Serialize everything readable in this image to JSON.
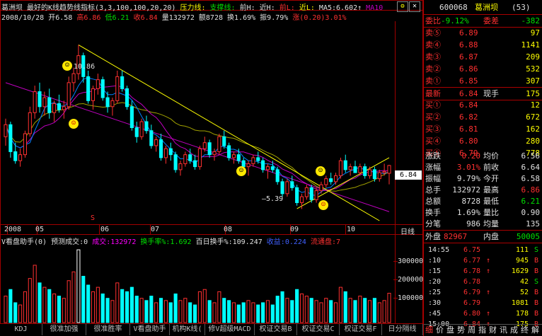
{
  "header": {
    "stock_name": "葛洲坝",
    "indicator_title": "最好的K线趋势线指标(3,3,100,100,20,20)",
    "pressure_label": "压力线:",
    "support_label": "支撑线:",
    "prev_high_label": "前H:",
    "recent_high_label": "近H:",
    "prev_low_label": "前L:",
    "recent_low_label": "近L:",
    "ma5_label": "MA5:6.602↑",
    "ma10_label": "MA10",
    "date": "2008/10/28",
    "open": "开6.58",
    "high": "高6.86",
    "low": "低6.21",
    "close": "收6.84",
    "volume": "量132972",
    "amount": "额8728",
    "turnover": "换1.69%",
    "amplitude": "振9.79%",
    "change": "涨(0.20)3.01%"
  },
  "annotations": {
    "high_label": "10.86",
    "low_label": "5.39",
    "price_tag": "6.84",
    "s_marker": "S"
  },
  "xaxis": {
    "labels": [
      "2008",
      "05",
      "06",
      "07",
      "08",
      "09",
      "10"
    ],
    "right_label": "日线"
  },
  "vol_header": {
    "title": "V看盘助手(0)",
    "forecast": "预测成交:0",
    "volume": "成交:132972",
    "turnover_rate": "换手率%:1.692",
    "hundred_day": "百日换手%:109.247",
    "profit": "收益:0.224",
    "float": "流通盘:7"
  },
  "vol_axis": [
    "300000",
    "200000",
    "100000"
  ],
  "toolbar": [
    "KDJ",
    "很准加强",
    "很准胜率",
    "V看盘助手",
    "机构K线(",
    "修V超级MACD",
    "权证交易B",
    "权证交易C",
    "权证交易F",
    "日分隔线"
  ],
  "toolbar_right": [
    "细",
    "价",
    "盘",
    "势",
    "周",
    "指",
    "财",
    "讯",
    "成",
    "终",
    "解"
  ],
  "quote": {
    "code": "600068",
    "name": "葛洲坝",
    "count": "(53)",
    "weibi_label": "委比",
    "weibi_value": "-9.12%",
    "weicha_label": "委差",
    "weicha_value": "-382",
    "sells": [
      {
        "label": "卖⑤",
        "price": "6.89",
        "vol": "97"
      },
      {
        "label": "卖④",
        "price": "6.88",
        "vol": "1141"
      },
      {
        "label": "卖③",
        "price": "6.87",
        "vol": "209"
      },
      {
        "label": "卖②",
        "price": "6.86",
        "vol": "532"
      },
      {
        "label": "卖①",
        "price": "6.85",
        "vol": "307"
      }
    ],
    "latest_label": "最新",
    "latest_value": "6.84",
    "xianshou_label": "现手",
    "xianshou_value": "175",
    "buys": [
      {
        "label": "买①",
        "price": "6.84",
        "vol": "12"
      },
      {
        "label": "买②",
        "price": "6.82",
        "vol": "672"
      },
      {
        "label": "买③",
        "price": "6.81",
        "vol": "162"
      },
      {
        "label": "买④",
        "price": "6.80",
        "vol": "280"
      },
      {
        "label": "买⑤",
        "price": "6.79",
        "vol": "778"
      }
    ],
    "stats": [
      {
        "l1": "涨跌",
        "v1": "0.20",
        "c1": "red",
        "l2": "均价",
        "v2": "6.56",
        "c2": "white"
      },
      {
        "l1": "涨幅",
        "v1": "3.01%",
        "c1": "red",
        "l2": "前收",
        "v2": "6.64",
        "c2": "white"
      },
      {
        "l1": "振幅",
        "v1": "9.79%",
        "c1": "white",
        "l2": "今开",
        "v2": "6.58",
        "c2": "white"
      },
      {
        "l1": "总手",
        "v1": "132972",
        "c1": "white",
        "l2": "最高",
        "v2": "6.86",
        "c2": "red"
      },
      {
        "l1": "总额",
        "v1": "8728",
        "c1": "white",
        "l2": "最低",
        "v2": "6.21",
        "c2": "green"
      },
      {
        "l1": "换手",
        "v1": "1.69%",
        "c1": "white",
        "l2": "量比",
        "v2": "0.90",
        "c2": "white"
      },
      {
        "l1": "分笔",
        "v1": "986",
        "c1": "white",
        "l2": "均量",
        "v2": "135",
        "c2": "white"
      }
    ],
    "outer_label": "外盘",
    "outer_value": "82967",
    "inner_label": "内盘",
    "inner_value": "50005"
  },
  "ticks": [
    {
      "time": "14:55",
      "price": "6.75",
      "arrow": "",
      "vol": "111",
      "side": "S"
    },
    {
      "time": ":10",
      "price": "6.77",
      "arrow": "↑",
      "vol": "945",
      "side": "B"
    },
    {
      "time": ":15",
      "price": "6.78",
      "arrow": "↑",
      "vol": "1629",
      "side": "B"
    },
    {
      "time": ":20",
      "price": "6.78",
      "arrow": "",
      "vol": "42",
      "side": "S"
    },
    {
      "time": ":25",
      "price": "6.79",
      "arrow": "↑",
      "vol": "52",
      "side": "B"
    },
    {
      "time": ":30",
      "price": "6.79",
      "arrow": "",
      "vol": "1081",
      "side": "B"
    },
    {
      "time": ":45",
      "price": "6.80",
      "arrow": "↑",
      "vol": "178",
      "side": "B"
    },
    {
      "time": "15:00",
      "price": "6.84",
      "arrow": "↑",
      "vol": "175",
      "side": "B"
    }
  ],
  "colors": {
    "up": "#ff3030",
    "down": "#00ffff",
    "ma5": "#ffffff",
    "ma10": "#c8c800",
    "ma20": "#c000c0",
    "ma60": "#0080ff",
    "trend": "#ffff00",
    "grid": "#a00000"
  },
  "chart_data": {
    "type": "candlestick",
    "ylim": [
      5.0,
      11.6
    ],
    "candles": [
      [
        7.8,
        8.4,
        7.5,
        8.2
      ],
      [
        8.2,
        8.3,
        7.1,
        7.3
      ],
      [
        7.3,
        7.6,
        6.9,
        7.0
      ],
      [
        7.0,
        7.4,
        6.8,
        7.2
      ],
      [
        7.2,
        8.0,
        7.1,
        7.9
      ],
      [
        7.9,
        8.8,
        7.8,
        8.6
      ],
      [
        8.6,
        9.5,
        8.4,
        9.3
      ],
      [
        9.3,
        9.6,
        8.6,
        8.8
      ],
      [
        8.8,
        9.3,
        8.5,
        9.1
      ],
      [
        9.1,
        9.4,
        8.4,
        8.6
      ],
      [
        8.6,
        9.0,
        8.3,
        8.9
      ],
      [
        8.9,
        9.2,
        8.6,
        8.7
      ],
      [
        8.7,
        9.0,
        8.4,
        8.8
      ],
      [
        8.8,
        9.8,
        8.7,
        9.6
      ],
      [
        9.6,
        10.1,
        9.3,
        9.9
      ],
      [
        9.9,
        10.86,
        9.7,
        10.5
      ],
      [
        10.5,
        10.6,
        9.6,
        9.8
      ],
      [
        9.8,
        10.0,
        8.9,
        9.0
      ],
      [
        9.0,
        9.5,
        8.7,
        9.4
      ],
      [
        9.4,
        9.9,
        9.2,
        9.7
      ],
      [
        9.7,
        9.8,
        9.0,
        9.1
      ],
      [
        9.1,
        9.3,
        8.6,
        8.8
      ],
      [
        8.8,
        9.1,
        8.5,
        9.0
      ],
      [
        9.0,
        10.0,
        8.9,
        9.8
      ],
      [
        9.8,
        10.0,
        9.3,
        9.4
      ],
      [
        9.4,
        9.5,
        8.7,
        8.8
      ],
      [
        8.8,
        9.0,
        8.0,
        8.1
      ],
      [
        8.1,
        8.3,
        7.6,
        7.8
      ],
      [
        7.8,
        8.4,
        7.7,
        8.3
      ],
      [
        8.3,
        8.5,
        7.9,
        8.0
      ],
      [
        8.0,
        8.2,
        7.4,
        7.5
      ],
      [
        7.5,
        7.8,
        7.3,
        7.7
      ],
      [
        7.7,
        7.9,
        7.0,
        7.1
      ],
      [
        7.1,
        7.5,
        6.9,
        7.4
      ],
      [
        7.4,
        7.6,
        7.0,
        7.2
      ],
      [
        7.2,
        7.3,
        6.6,
        6.7
      ],
      [
        6.7,
        7.0,
        6.5,
        6.9
      ],
      [
        6.9,
        7.3,
        6.8,
        7.2
      ],
      [
        7.2,
        7.4,
        6.9,
        7.0
      ],
      [
        7.0,
        7.2,
        6.7,
        6.8
      ],
      [
        6.8,
        7.5,
        6.7,
        7.4
      ],
      [
        7.4,
        7.8,
        7.3,
        7.6
      ],
      [
        7.6,
        7.7,
        7.1,
        7.2
      ],
      [
        7.2,
        7.4,
        7.0,
        7.3
      ],
      [
        7.3,
        7.9,
        7.2,
        7.8
      ],
      [
        7.8,
        8.0,
        7.4,
        7.5
      ],
      [
        7.5,
        7.6,
        7.0,
        7.1
      ],
      [
        7.1,
        7.3,
        6.9,
        7.2
      ],
      [
        7.2,
        7.4,
        6.9,
        7.0
      ],
      [
        7.0,
        7.1,
        6.7,
        6.8
      ],
      [
        6.8,
        7.0,
        6.5,
        6.9
      ],
      [
        6.9,
        7.2,
        6.8,
        7.1
      ],
      [
        7.1,
        7.3,
        6.9,
        7.0
      ],
      [
        7.0,
        7.1,
        6.6,
        6.7
      ],
      [
        6.7,
        6.9,
        6.4,
        6.8
      ],
      [
        6.8,
        7.0,
        6.6,
        6.7
      ],
      [
        6.7,
        6.8,
        6.2,
        6.3
      ],
      [
        6.3,
        6.4,
        5.8,
        5.9
      ],
      [
        5.9,
        6.4,
        5.8,
        6.3
      ],
      [
        6.3,
        6.5,
        6.0,
        6.1
      ],
      [
        6.1,
        6.2,
        5.5,
        5.6
      ],
      [
        5.6,
        5.9,
        5.39,
        5.8
      ],
      [
        5.8,
        6.2,
        5.7,
        6.1
      ],
      [
        6.1,
        6.2,
        5.6,
        5.7
      ],
      [
        5.7,
        6.1,
        5.6,
        6.0
      ],
      [
        6.0,
        6.3,
        5.9,
        6.2
      ],
      [
        6.2,
        6.5,
        6.1,
        6.4
      ],
      [
        6.4,
        6.6,
        6.2,
        6.3
      ],
      [
        6.3,
        6.6,
        6.2,
        6.5
      ],
      [
        6.5,
        7.1,
        6.4,
        7.0
      ],
      [
        7.0,
        7.2,
        6.6,
        6.7
      ],
      [
        6.7,
        6.9,
        6.5,
        6.8
      ],
      [
        6.8,
        7.0,
        6.6,
        6.6
      ],
      [
        6.6,
        6.9,
        6.5,
        6.8
      ],
      [
        6.8,
        6.9,
        6.4,
        6.5
      ],
      [
        6.5,
        6.8,
        6.4,
        6.7
      ],
      [
        6.7,
        6.8,
        6.3,
        6.4
      ],
      [
        6.4,
        6.7,
        6.3,
        6.6
      ],
      [
        6.6,
        6.9,
        6.5,
        6.64
      ],
      [
        6.58,
        6.86,
        6.21,
        6.84
      ]
    ],
    "volumes": [
      120000,
      150000,
      90000,
      80000,
      140000,
      200000,
      260000,
      180000,
      160000,
      150000,
      130000,
      120000,
      110000,
      190000,
      230000,
      330000,
      210000,
      170000,
      140000,
      160000,
      130000,
      110000,
      100000,
      180000,
      150000,
      140000,
      160000,
      120000,
      110000,
      100000,
      120000,
      90000,
      110000,
      100000,
      90000,
      130000,
      100000,
      110000,
      90000,
      80000,
      140000,
      150000,
      100000,
      90000,
      140000,
      110000,
      100000,
      90000,
      80000,
      90000,
      100000,
      90000,
      80000,
      90000,
      100000,
      80000,
      120000,
      140000,
      110000,
      100000,
      150000,
      130000,
      120000,
      110000,
      100000,
      90000,
      110000,
      100000,
      90000,
      160000,
      140000,
      110000,
      100000,
      120000,
      110000,
      100000,
      110000,
      90000,
      100000,
      132972
    ]
  }
}
